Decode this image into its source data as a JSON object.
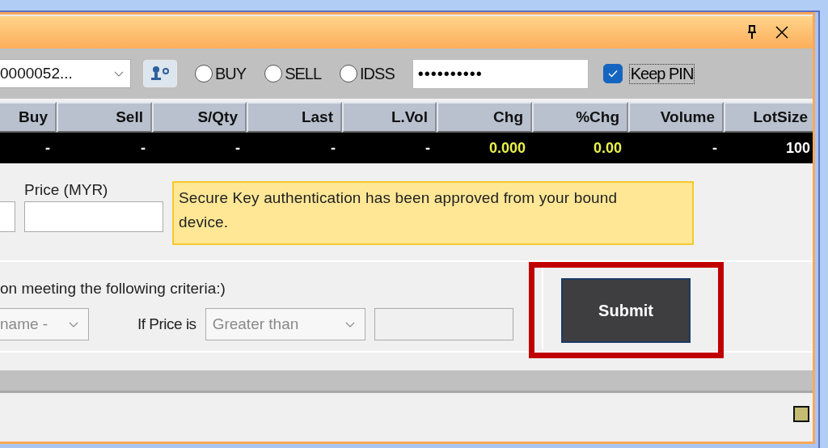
{
  "window": {
    "pinnable": true,
    "closable": true
  },
  "toolbar": {
    "account": {
      "value": "0000052..."
    },
    "radios": [
      {
        "label": "BUY",
        "selected": false
      },
      {
        "label": "SELL",
        "selected": false
      },
      {
        "label": "IDSS",
        "selected": false
      }
    ],
    "pin": {
      "value": "••••••••••"
    },
    "keep_pin": {
      "label": "Keep PIN",
      "checked": true
    }
  },
  "table": {
    "columns": [
      "Buy",
      "Sell",
      "S/Qty",
      "Last",
      "L.Vol",
      "Chg",
      "%Chg",
      "Volume",
      "LotSize"
    ],
    "rows": [
      [
        {
          "text": "-",
          "color": "#ffffff"
        },
        {
          "text": "-",
          "color": "#ffffff"
        },
        {
          "text": "-",
          "color": "#ffffff"
        },
        {
          "text": "-",
          "color": "#ffffff"
        },
        {
          "text": "-",
          "color": "#ffffff"
        },
        {
          "text": "0.000",
          "color": "#eaf24a"
        },
        {
          "text": "0.00",
          "color": "#eaf24a"
        },
        {
          "text": "-",
          "color": "#ffffff"
        },
        {
          "text": "100",
          "color": "#ffffff"
        }
      ]
    ]
  },
  "order": {
    "price_label": "Price (MYR)",
    "notice": "Secure Key authentication has been approved from your bound device."
  },
  "criteria": {
    "text": "on meeting the following criteria:)",
    "field": {
      "value": "name -",
      "disabled": true
    },
    "condition_label": "If Price is",
    "condition": {
      "value": "Greater than",
      "disabled": true
    },
    "price_field": {
      "disabled": true
    }
  },
  "submit": {
    "label": "Submit",
    "highlighted": true
  }
}
